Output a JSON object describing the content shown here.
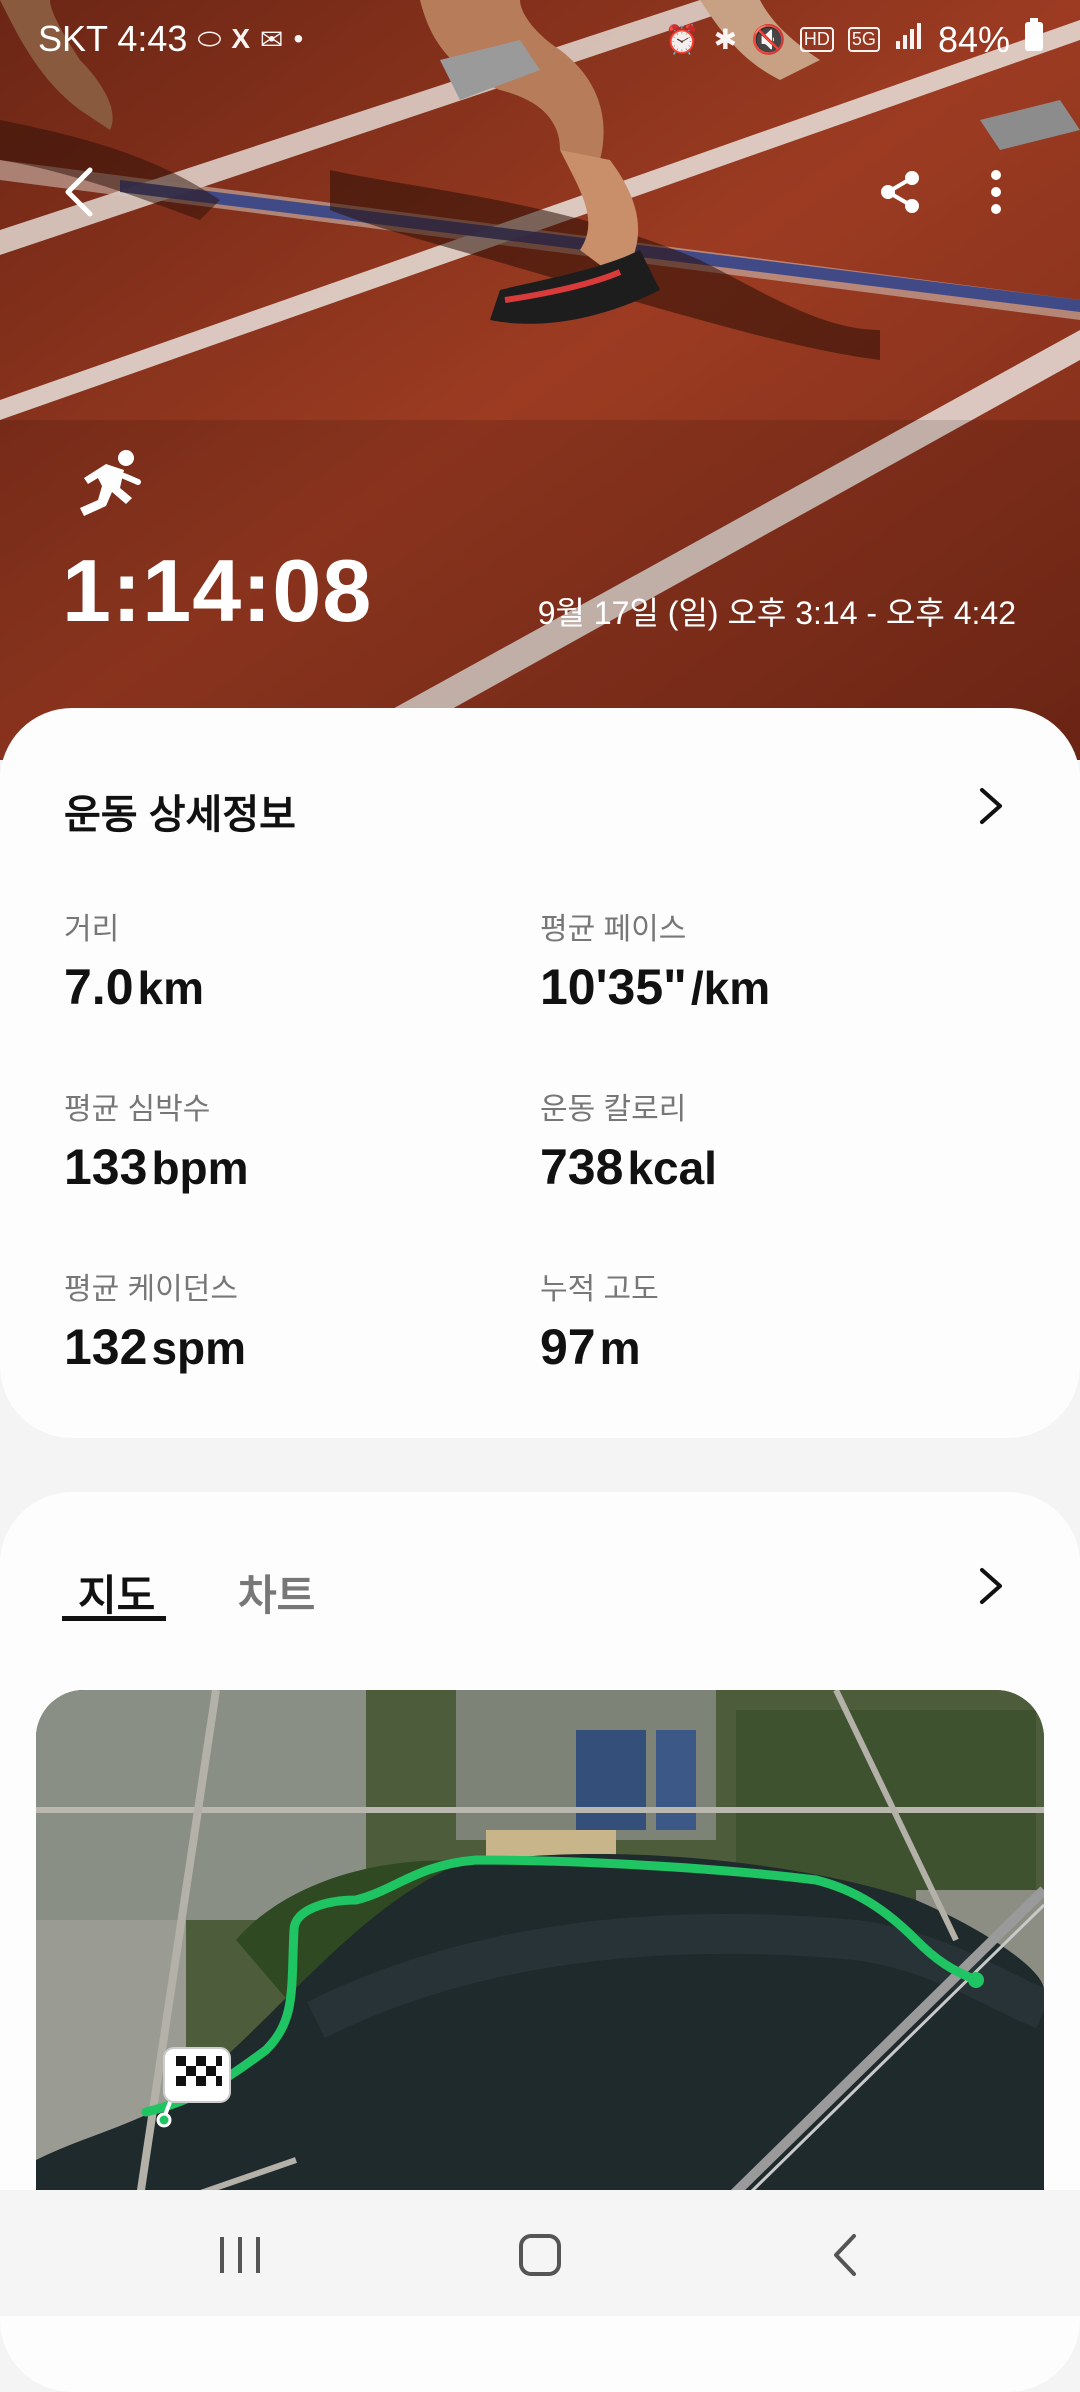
{
  "status_bar": {
    "carrier_time": "SKT 4:43",
    "battery": "84%",
    "icons_left": [
      "pill-icon",
      "x-logo-icon",
      "mail-icon",
      "dot-icon"
    ],
    "icons_right": [
      "alarm-icon",
      "bluetooth-icon",
      "mute-icon",
      "hd-voice-icon",
      "5g-icon",
      "signal-icon",
      "battery-icon"
    ]
  },
  "hero": {
    "duration": "1:14:08",
    "date_range": "9월 17일 (일) 오후 3:14 - 오후 4:42",
    "activity_icon": "running-icon"
  },
  "details": {
    "title": "운동 상세정보",
    "stats": [
      {
        "label": "거리",
        "value": "7.0",
        "unit": "km"
      },
      {
        "label": "평균 페이스",
        "value": "10'35\"",
        "unit": "/km"
      },
      {
        "label": "평균 심박수",
        "value": "133",
        "unit": "bpm"
      },
      {
        "label": "운동 칼로리",
        "value": "738",
        "unit": "kcal"
      },
      {
        "label": "평균 케이던스",
        "value": "132",
        "unit": "spm"
      },
      {
        "label": "누적 고도",
        "value": "97",
        "unit": "m"
      }
    ]
  },
  "map_section": {
    "tabs": [
      {
        "label": "지도",
        "active": true
      },
      {
        "label": "차트",
        "active": false
      }
    ],
    "route_color": "#1fc463"
  },
  "colors": {
    "track": "#8e3420",
    "card_bg": "#fdfdfd",
    "route": "#1fc463"
  }
}
